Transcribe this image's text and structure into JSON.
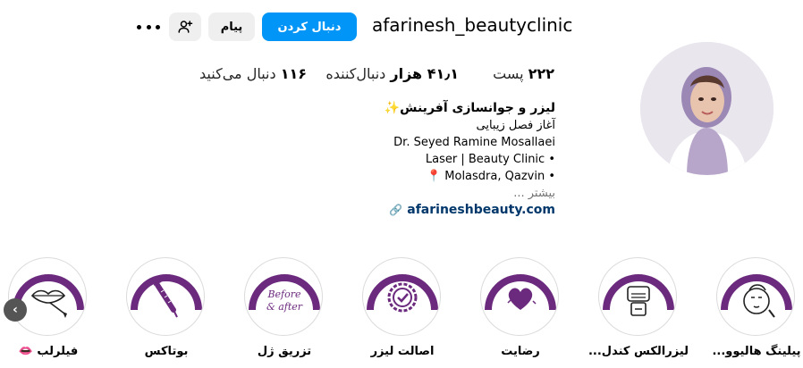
{
  "profile": {
    "username": "afarinesh_beautyclinic",
    "follow_label": "دنبال کردن",
    "message_label": "پیام",
    "add_user_icon": "add-user-icon",
    "more_icon": "more-options-icon"
  },
  "stats": {
    "posts": {
      "count": "۲۲۲",
      "label": "پست"
    },
    "followers": {
      "count": "۴۱٫۱ هزار",
      "label": "دنبال‌کننده"
    },
    "following": {
      "count": "۱۱۶",
      "label": "دنبال می‌کنید"
    }
  },
  "bio": {
    "name": "لیزر و جوانسازی آفرینش✨",
    "line1": "آغاز فصل زیبایی",
    "line2": "Dr. Seyed Ramine Mosallaei",
    "line3": "Laser | Beauty Clinic •",
    "line4": "📍 Molasdra, Qazvin •",
    "more": "بیشتر ...",
    "link": "afarineshbeauty.com"
  },
  "highlights": [
    {
      "label": "پیلینگ هالیوو...",
      "icon": "face-peeling-icon"
    },
    {
      "label": "لیزرالکس کندل...",
      "icon": "laser-device-icon"
    },
    {
      "label": "رضایت",
      "icon": "heart-satisfaction-icon"
    },
    {
      "label": "اصالت لیزر",
      "icon": "verified-badge-icon"
    },
    {
      "label": "تزریق ژل",
      "icon": "before-after-icon"
    },
    {
      "label": "بوتاکس",
      "icon": "syringe-icon"
    },
    {
      "label": "فیلرلب 👄",
      "icon": "lips-filler-icon"
    }
  ],
  "colors": {
    "accent": "#0095f6",
    "highlight_purple": "#6b2a7d",
    "link": "#00376b"
  },
  "highlight_texts": {
    "before_after_1": "Before",
    "before_after_2": "& after"
  }
}
